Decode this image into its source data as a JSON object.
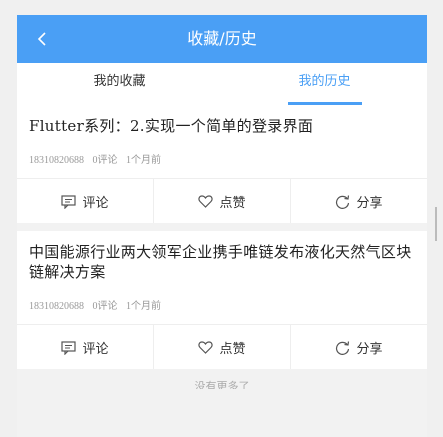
{
  "header": {
    "title": "收藏/历史",
    "back_icon": "chevron-left-icon"
  },
  "tabs": [
    {
      "label": "我的收藏",
      "active": false
    },
    {
      "label": "我的历史",
      "active": true
    }
  ],
  "articles": [
    {
      "title": "Flutter系列：2.实现一个简单的登录界面",
      "author": "18310820688",
      "comments": "0评论",
      "time": "1个月前",
      "actions": {
        "comment": "评论",
        "like": "点赞",
        "share": "分享"
      }
    },
    {
      "title": "中国能源行业两大领军企业携手唯链发布液化天然气区块链解决方案",
      "author": "18310820688",
      "comments": "0评论",
      "time": "1个月前",
      "actions": {
        "comment": "评论",
        "like": "点赞",
        "share": "分享"
      }
    }
  ],
  "footer": {
    "text": "没有更多了"
  },
  "colors": {
    "accent": "#4a9ff5",
    "background": "#f2f2f2"
  }
}
